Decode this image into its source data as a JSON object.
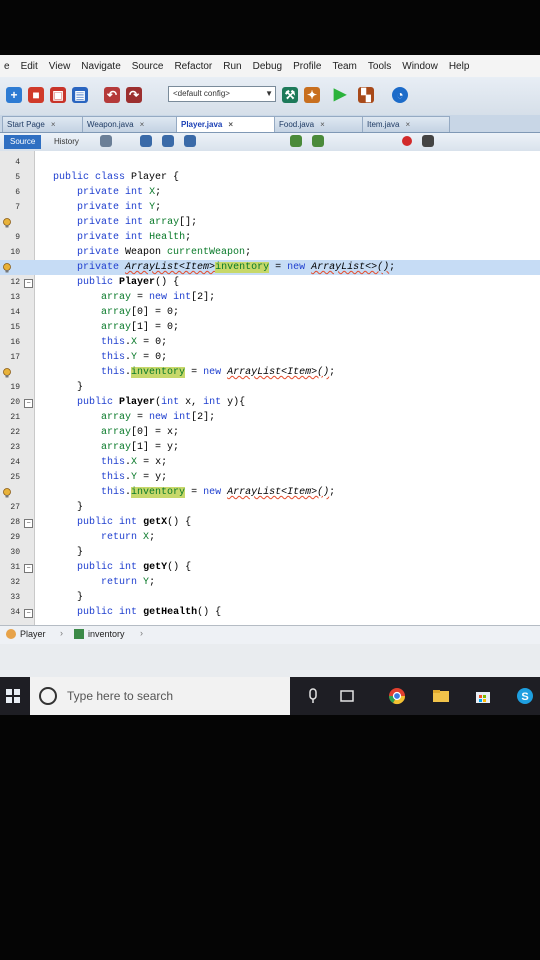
{
  "menu": [
    "e",
    "Edit",
    "View",
    "Navigate",
    "Source",
    "Refactor",
    "Run",
    "Debug",
    "Profile",
    "Team",
    "Tools",
    "Window",
    "Help"
  ],
  "toolbar": {
    "config": "<default config>"
  },
  "tabs": [
    {
      "label": "Start Page",
      "active": false
    },
    {
      "label": "Weapon.java",
      "active": false
    },
    {
      "label": "Player.java",
      "active": true
    },
    {
      "label": "Food.java",
      "active": false
    },
    {
      "label": "Item.java",
      "active": false
    }
  ],
  "subtabs": {
    "source": "Source",
    "history": "History"
  },
  "code_lines": [
    {
      "n": "4",
      "text": ""
    },
    {
      "n": "5",
      "text": "public class Player {"
    },
    {
      "n": "6",
      "text": "    private int X;"
    },
    {
      "n": "7",
      "text": "    private int Y;"
    },
    {
      "n": "8",
      "text": "    private int array[];"
    },
    {
      "n": "9",
      "text": "    private int Health;"
    },
    {
      "n": "10",
      "text": "    private Weapon currentWeapon;"
    },
    {
      "n": "11",
      "text": "    private ArrayList<Item>inventory = new ArrayList<>();"
    },
    {
      "n": "12",
      "text": "    public Player() {"
    },
    {
      "n": "13",
      "text": "        array = new int[2];"
    },
    {
      "n": "14",
      "text": "        array[0] = 0;"
    },
    {
      "n": "15",
      "text": "        array[1] = 0;"
    },
    {
      "n": "16",
      "text": "        this.X = 0;"
    },
    {
      "n": "17",
      "text": "        this.Y = 0;"
    },
    {
      "n": "18",
      "text": "        this.inventory = new ArrayList<Item>();"
    },
    {
      "n": "19",
      "text": "    }"
    },
    {
      "n": "20",
      "text": "    public Player(int x, int y){"
    },
    {
      "n": "21",
      "text": "        array = new int[2];"
    },
    {
      "n": "22",
      "text": "        array[0] = x;"
    },
    {
      "n": "23",
      "text": "        array[1] = y;"
    },
    {
      "n": "24",
      "text": "        this.X = x;"
    },
    {
      "n": "25",
      "text": "        this.Y = y;"
    },
    {
      "n": "26",
      "text": "        this.inventory = new ArrayList<Item>();"
    },
    {
      "n": "27",
      "text": "    }"
    },
    {
      "n": "28",
      "text": "    public int getX() {"
    },
    {
      "n": "29",
      "text": "        return X;"
    },
    {
      "n": "30",
      "text": "    }"
    },
    {
      "n": "31",
      "text": "    public int getY() {"
    },
    {
      "n": "32",
      "text": "        return Y;"
    },
    {
      "n": "33",
      "text": "    }"
    },
    {
      "n": "34",
      "text": "    public int getHealth() {"
    }
  ],
  "breadcrumb": {
    "class": "Player",
    "member": "inventory"
  },
  "taskbar": {
    "search_placeholder": "Type here to search"
  },
  "colors": {
    "keyword": "#1f3fcf",
    "field": "#0a7a2a",
    "occurrence": "#c7d86a",
    "current_line": "#c6dcf5"
  }
}
